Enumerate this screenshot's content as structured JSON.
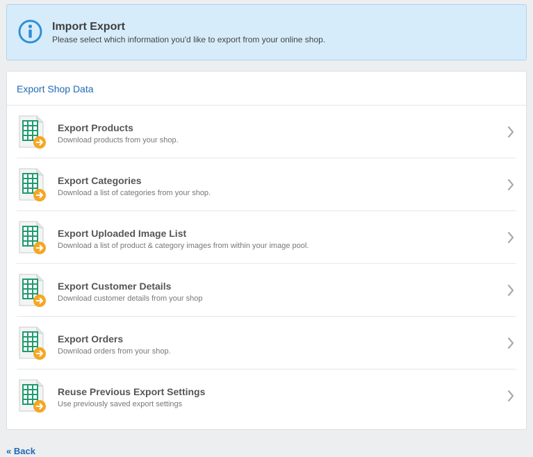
{
  "info": {
    "title": "Import Export",
    "text": "Please select which information you'd like to export from your online shop.",
    "icon": "info-icon"
  },
  "panel": {
    "title": "Export Shop Data",
    "items": [
      {
        "title": "Export Products",
        "desc": "Download products from your shop."
      },
      {
        "title": "Export Categories",
        "desc": "Download a list of categories from your shop."
      },
      {
        "title": "Export Uploaded Image List",
        "desc": "Download a list of product & category images from within your image pool."
      },
      {
        "title": "Export Customer Details",
        "desc": "Download customer details from your shop"
      },
      {
        "title": "Export Orders",
        "desc": "Download orders from your shop."
      },
      {
        "title": "Reuse Previous Export Settings",
        "desc": "Use previously saved export settings"
      }
    ]
  },
  "back": {
    "label": "« Back"
  },
  "colors": {
    "accent": "#1f6bb5",
    "info_bg": "#d7ecfb",
    "sheet_green": "#1f9a6e",
    "arrow_orange": "#f5a623"
  }
}
